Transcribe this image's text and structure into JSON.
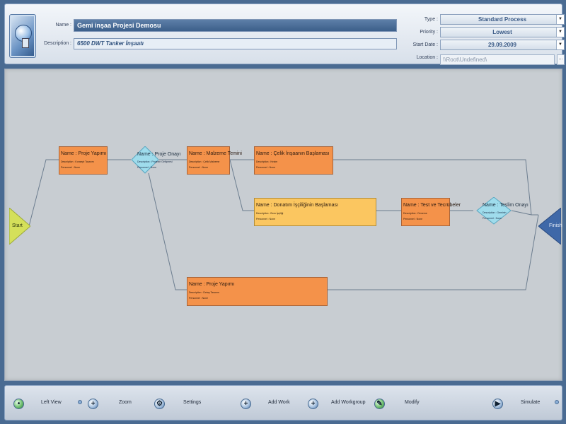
{
  "header": {
    "name_label": "Name :",
    "name_value": "Gemi inşaa Projesi Demosu",
    "description_label": "Description :",
    "description_value": "6500 DWT Tanker İnşaatı",
    "type_label": "Type :",
    "type_value": "Standard Process",
    "priority_label": "Priority :",
    "priority_value": "Lowest",
    "startdate_label": "Start Date :",
    "startdate_value": "29.09.2009",
    "location_label": "Location :",
    "location_value": "\\\\Root\\Undefined\\",
    "location_browse": "..."
  },
  "diagram": {
    "start_label": "Start",
    "finish_label": "Finish",
    "works": [
      {
        "id": "w1",
        "name": "Name : Proje Yapımı",
        "description": "Description : Konsept Tasarım",
        "personnel": "Personnel : None"
      },
      {
        "id": "w2",
        "name": "Name : Malzeme Temini",
        "description": "Description : Çelik Malzeme",
        "personnel": "Personnel : None"
      },
      {
        "id": "w3",
        "name": "Name : Çelik İnşaanın Başlaması",
        "description": "Description : Kesim",
        "personnel": "Personnel : None"
      },
      {
        "id": "w4",
        "name": "Name : Donatım İşçiliğinin Başlaması",
        "description": "Description : Boru İşçiliği",
        "personnel": "Personnel : None"
      },
      {
        "id": "w5",
        "name": "Name : Test ve Tecrübeler",
        "description": "Description : Deneme",
        "personnel": "Personnel : None"
      },
      {
        "id": "w6",
        "name": "Name : Proje Yapımı",
        "description": "Description : Detay Tasarım",
        "personnel": "Personnel : None"
      }
    ],
    "decisions": [
      {
        "id": "d1",
        "name": "Name : Proje Onayı",
        "description": "Description : Projenin Gelişmesi",
        "personnel": "Personnel : None"
      },
      {
        "id": "d2",
        "name": "Name : Teslim Onayı",
        "description": "Description : Geminin",
        "personnel": "Personnel : None"
      }
    ]
  },
  "toolbar": {
    "left_view": "Left View",
    "zoom": "Zoom",
    "settings": "Settings",
    "add_work": "Add Work",
    "add_workgroup": "Add Workgroup",
    "modify": "Modify",
    "simulate": "Simulate"
  },
  "colors": {
    "work_fill": "#f4924a",
    "work_highlight_fill": "#fbc660",
    "decision_fill": "#9fdcec",
    "start_fill": "#d4e05a",
    "finish_fill": "#3f68a8",
    "canvas": "#c8cdd2"
  }
}
